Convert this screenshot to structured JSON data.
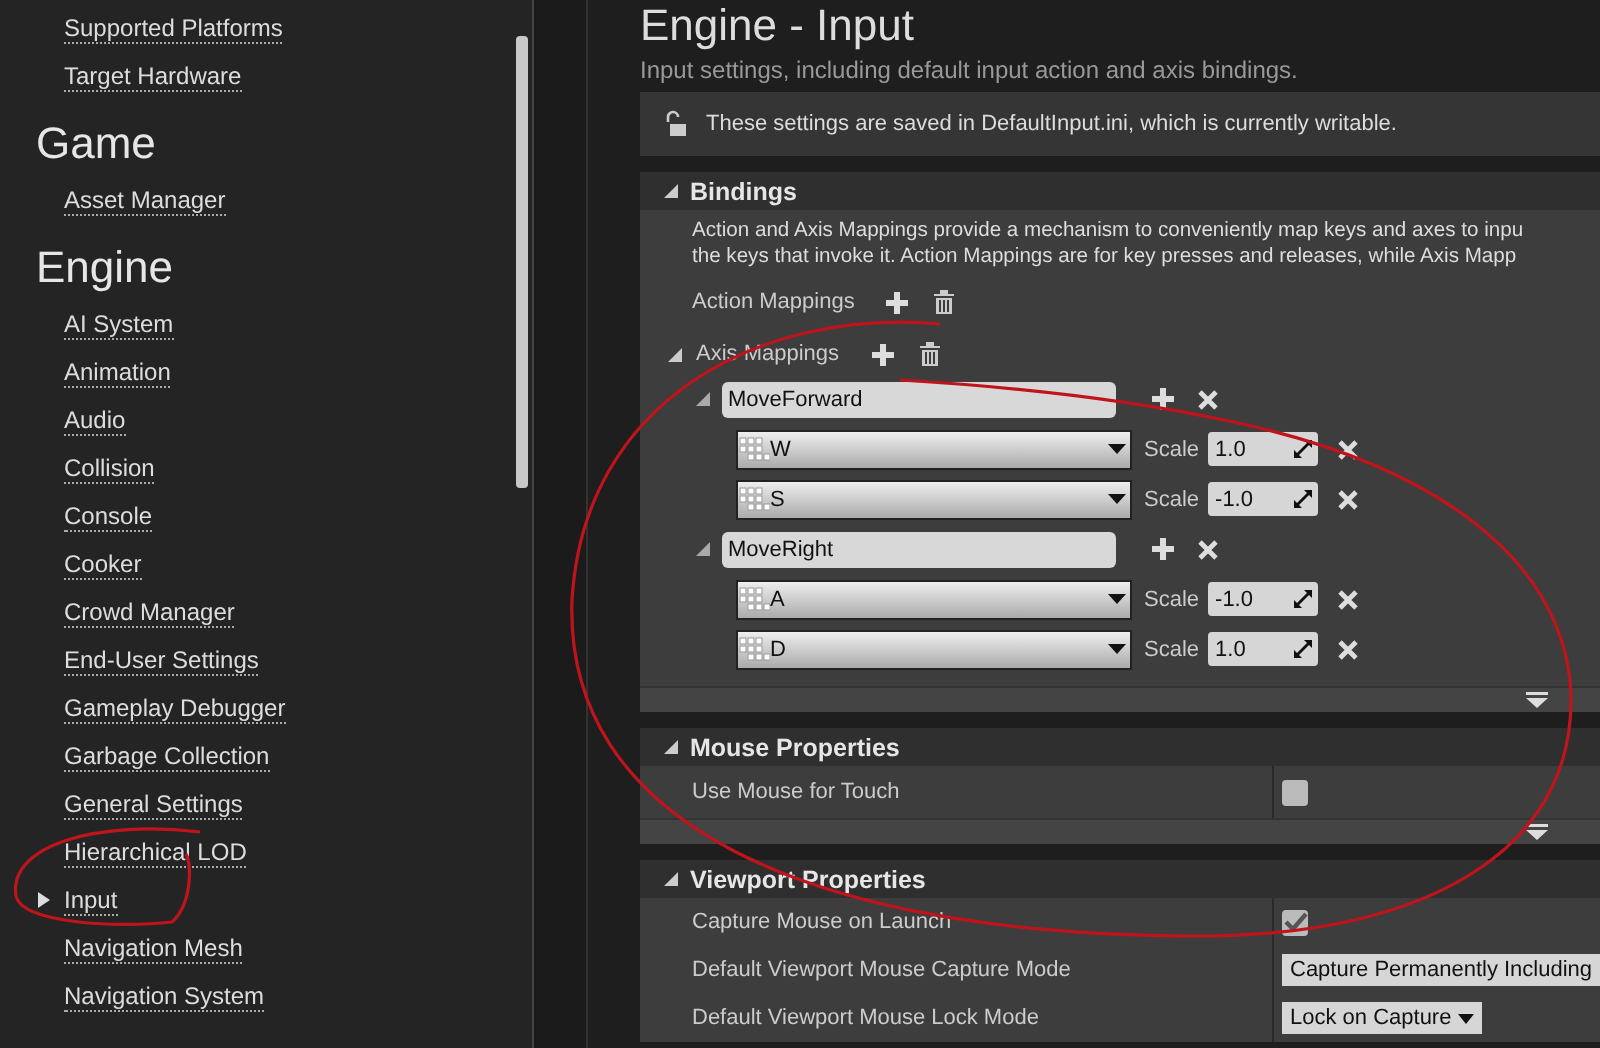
{
  "sidebar": {
    "items": [
      {
        "kind": "link",
        "label": "Supported Platforms",
        "selected": false
      },
      {
        "kind": "link",
        "label": "Target Hardware",
        "selected": false
      },
      {
        "kind": "heading",
        "label": "Game"
      },
      {
        "kind": "link",
        "label": "Asset Manager",
        "selected": false
      },
      {
        "kind": "heading",
        "label": "Engine"
      },
      {
        "kind": "link",
        "label": "AI System",
        "selected": false
      },
      {
        "kind": "link",
        "label": "Animation",
        "selected": false
      },
      {
        "kind": "link",
        "label": "Audio",
        "selected": false
      },
      {
        "kind": "link",
        "label": "Collision",
        "selected": false
      },
      {
        "kind": "link",
        "label": "Console",
        "selected": false
      },
      {
        "kind": "link",
        "label": "Cooker",
        "selected": false
      },
      {
        "kind": "link",
        "label": "Crowd Manager",
        "selected": false
      },
      {
        "kind": "link",
        "label": "End-User Settings",
        "selected": false
      },
      {
        "kind": "link",
        "label": "Gameplay Debugger",
        "selected": false
      },
      {
        "kind": "link",
        "label": "Garbage Collection",
        "selected": false
      },
      {
        "kind": "link",
        "label": "General Settings",
        "selected": false
      },
      {
        "kind": "link",
        "label": "Hierarchical LOD",
        "selected": false
      },
      {
        "kind": "link",
        "label": "Input",
        "selected": true
      },
      {
        "kind": "link",
        "label": "Navigation Mesh",
        "selected": false
      },
      {
        "kind": "link",
        "label": "Navigation System",
        "selected": false
      }
    ]
  },
  "page": {
    "title": "Engine - Input",
    "subtitle": "Input settings, including default input action and axis bindings.",
    "notice": "These settings are saved in DefaultInput.ini, which is currently writable."
  },
  "bindings": {
    "title": "Bindings",
    "expanded": true,
    "description": [
      "Action and Axis Mappings provide a mechanism to conveniently map keys and axes to inpu",
      "the keys that invoke it. Action Mappings are for key presses and releases, while Axis Mapp"
    ],
    "action_mappings": {
      "label": "Action Mappings"
    },
    "axis_mappings": {
      "label": "Axis Mappings",
      "expanded": true,
      "mappings": [
        {
          "name": "MoveForward",
          "expanded": true,
          "keys": [
            {
              "key": "W",
              "scale_label": "Scale",
              "scale": "1.0"
            },
            {
              "key": "S",
              "scale_label": "Scale",
              "scale": "-1.0"
            }
          ]
        },
        {
          "name": "MoveRight",
          "expanded": true,
          "keys": [
            {
              "key": "A",
              "scale_label": "Scale",
              "scale": "-1.0"
            },
            {
              "key": "D",
              "scale_label": "Scale",
              "scale": "1.0"
            }
          ]
        }
      ]
    }
  },
  "sections": [
    {
      "title": "Mouse Properties",
      "expanded": true,
      "rows": [
        {
          "kind": "checkbox",
          "label": "Use Mouse for Touch",
          "checked": false
        }
      ]
    },
    {
      "title": "Viewport Properties",
      "expanded": true,
      "rows": [
        {
          "kind": "checkbox",
          "label": "Capture Mouse on Launch",
          "checked": true
        },
        {
          "kind": "dropdown",
          "label": "Default Viewport Mouse Capture Mode",
          "value": "Capture Permanently Including"
        },
        {
          "kind": "dropdown",
          "label": "Default Viewport Mouse Lock Mode",
          "value": "Lock on Capture"
        }
      ]
    }
  ]
}
